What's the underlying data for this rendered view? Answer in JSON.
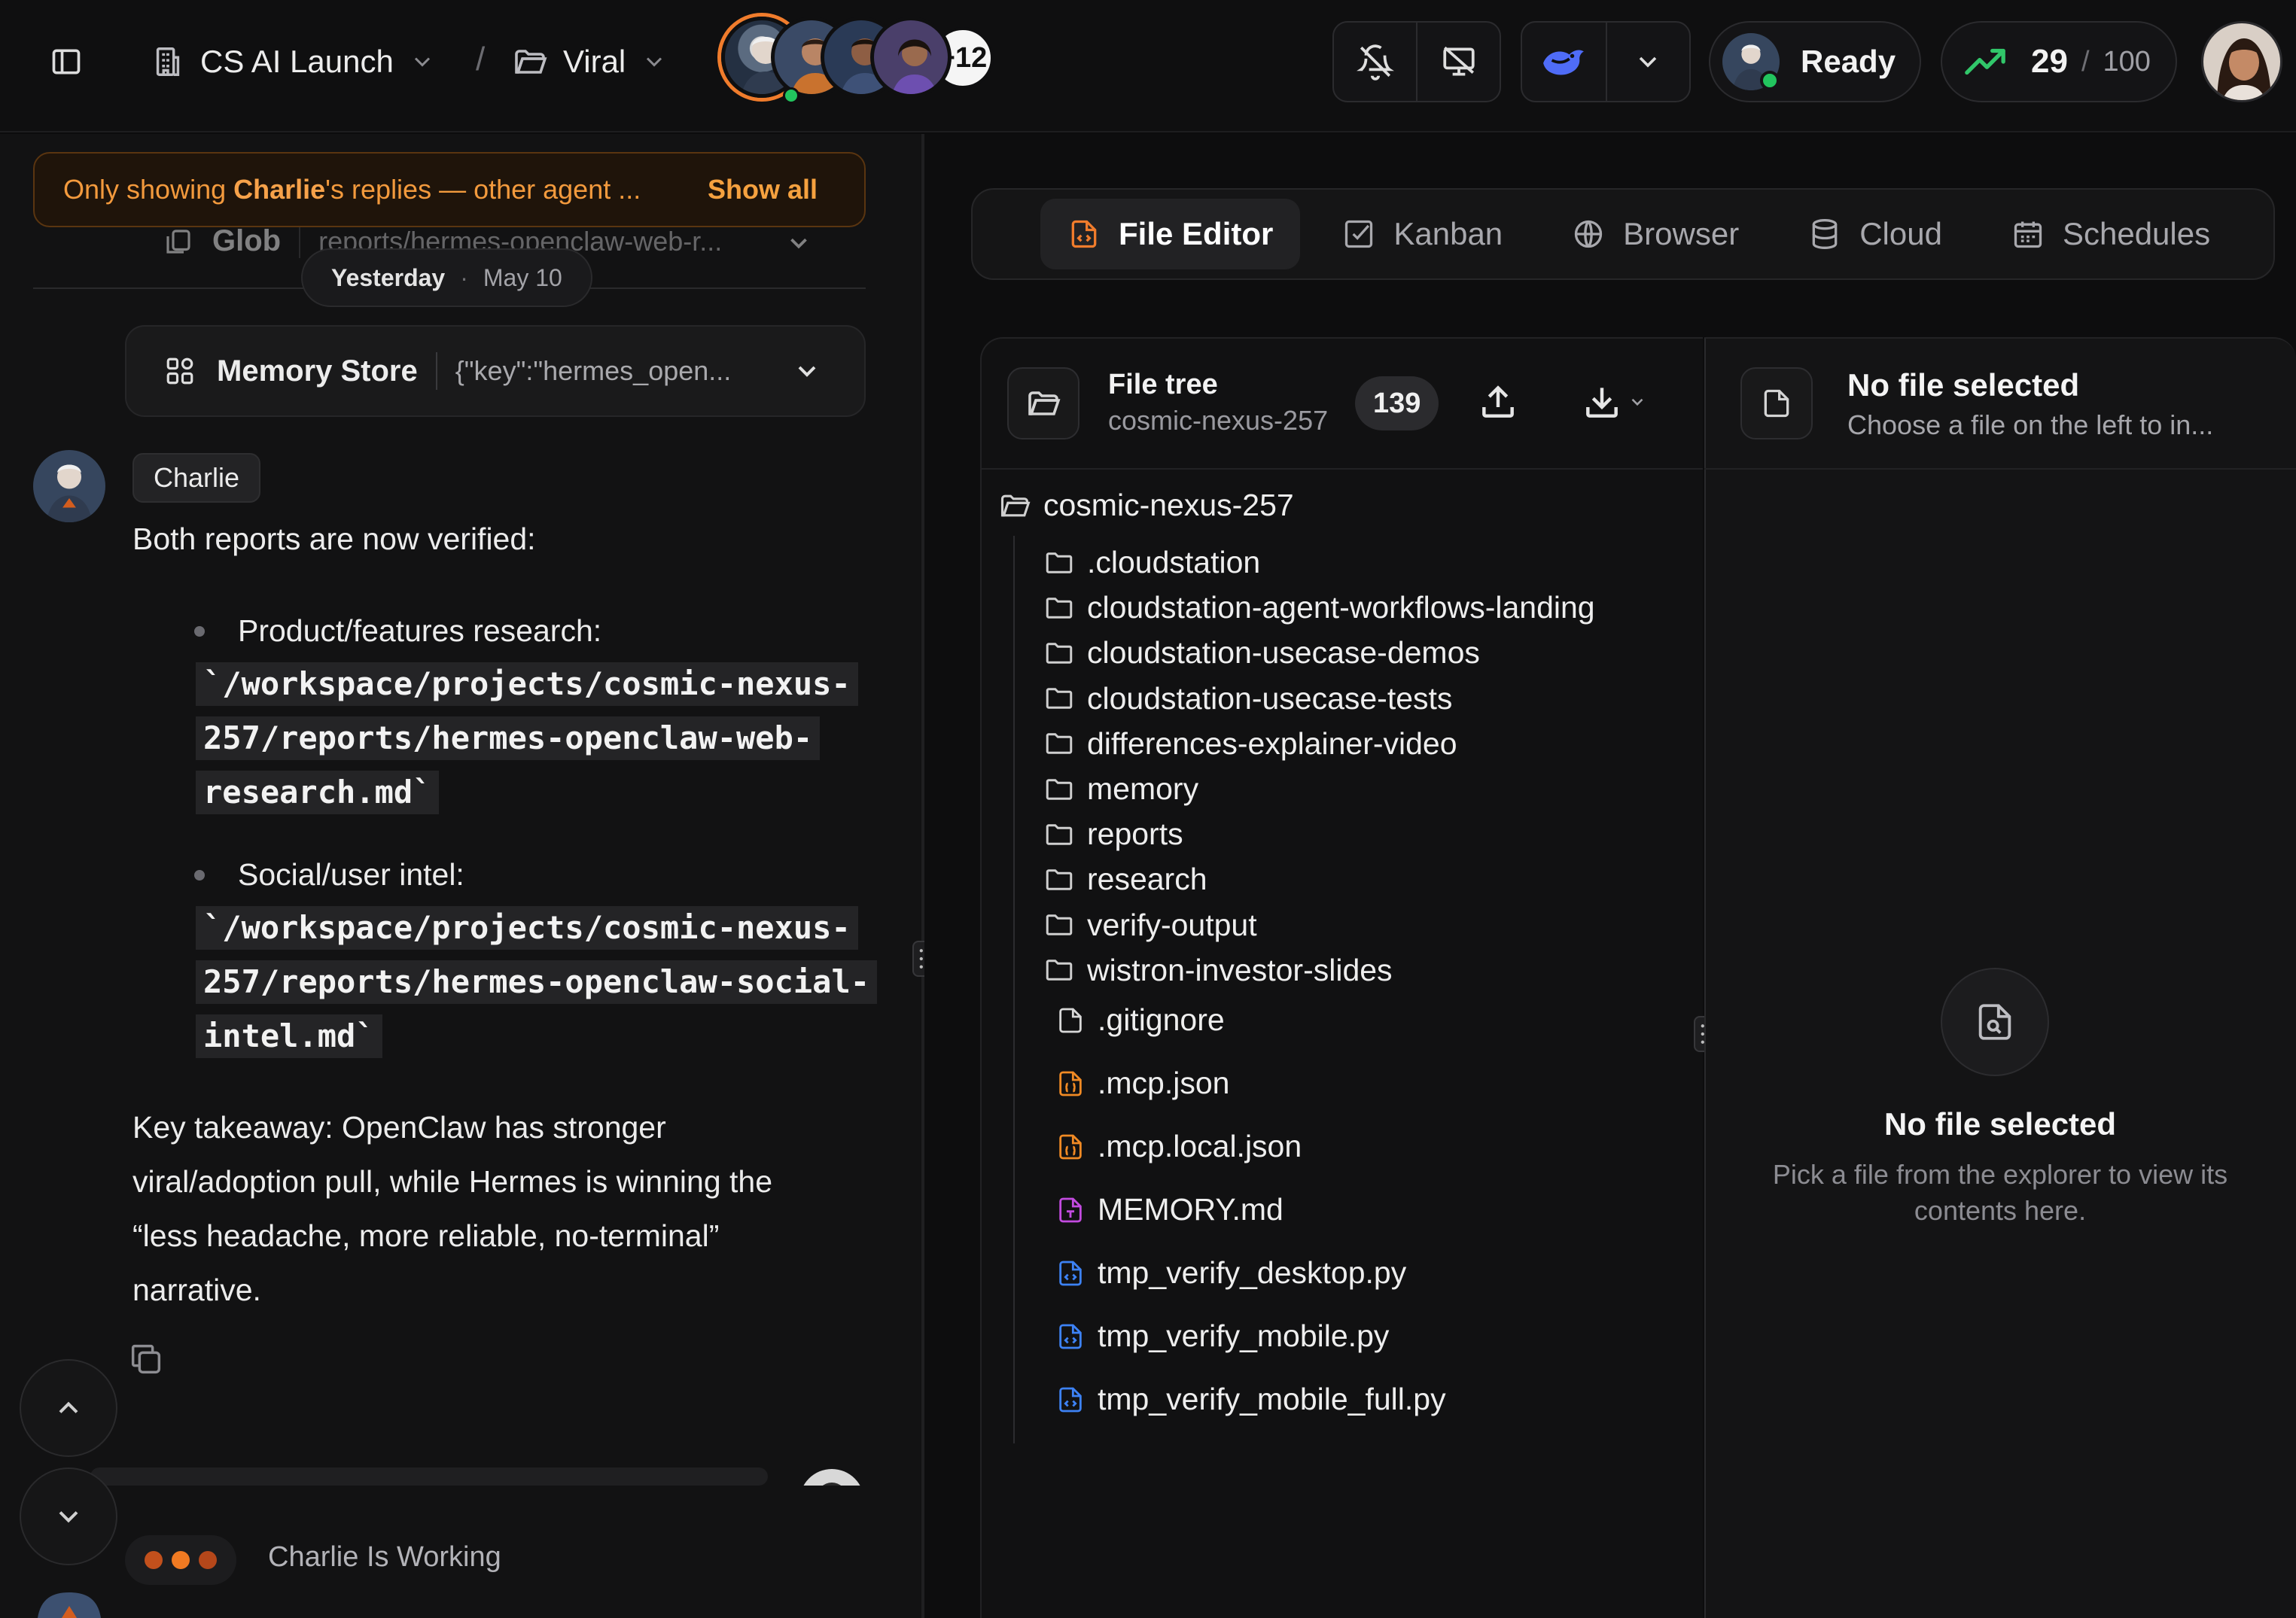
{
  "topbar": {
    "workspace": "CS AI Launch",
    "project": "Viral",
    "extra_members": "+12",
    "status": "Ready",
    "usage_current": "29",
    "usage_sep": "/",
    "usage_max": "100"
  },
  "chat": {
    "filter_banner": {
      "prefix": "Only showing ",
      "agent": "Charlie",
      "suffix": "'s replies — other agent ...",
      "action": "Show all"
    },
    "faded_card": {
      "title": "Glob",
      "value": "reports/hermes-openclaw-web-r..."
    },
    "date": {
      "relative": "Yesterday",
      "sep": "·",
      "absolute": "May 10"
    },
    "memory_card": {
      "title": "Memory Store",
      "value": "{\"key\":\"hermes_open..."
    },
    "message": {
      "author": "Charlie",
      "intro": "Both reports are now verified:",
      "bullets": [
        {
          "label": "Product/features research:",
          "code_lines": [
            "`/workspace/projects/cosmic-nexus-",
            "257/reports/hermes-openclaw-web-",
            "research.md`"
          ]
        },
        {
          "label": "Social/user intel:",
          "code_lines": [
            "`/workspace/projects/cosmic-nexus-",
            "257/reports/hermes-openclaw-social-",
            "intel.md`"
          ]
        }
      ],
      "takeaway_lines": [
        "Key takeaway: OpenClaw has stronger",
        "viral/adoption pull, while Hermes is winning the",
        "“less headache, more reliable, no-terminal”",
        "narrative."
      ]
    },
    "working_status": "Charlie Is Working",
    "working_dot_colors": [
      "#c2501c",
      "#f07a22",
      "#b5471a"
    ]
  },
  "workspace": {
    "tabs": [
      {
        "label": "File Editor",
        "active": true
      },
      {
        "label": "Kanban",
        "active": false
      },
      {
        "label": "Browser",
        "active": false
      },
      {
        "label": "Cloud",
        "active": false
      },
      {
        "label": "Schedules",
        "active": false
      }
    ],
    "file_tree": {
      "title": "File tree",
      "subtitle": "cosmic-nexus-257",
      "count": "139",
      "root": "cosmic-nexus-257",
      "folders": [
        ".cloudstation",
        "cloudstation-agent-workflows-landing",
        "cloudstation-usecase-demos",
        "cloudstation-usecase-tests",
        "differences-explainer-video",
        "memory",
        "reports",
        "research",
        "verify-output",
        "wistron-investor-slides"
      ],
      "files": [
        {
          "name": ".gitignore",
          "icon": "file-icon",
          "color": "#d8d8d8"
        },
        {
          "name": ".mcp.json",
          "icon": "json-file-icon",
          "color": "#f08a24"
        },
        {
          "name": ".mcp.local.json",
          "icon": "json-file-icon",
          "color": "#f08a24"
        },
        {
          "name": "MEMORY.md",
          "icon": "markdown-file-icon",
          "color": "#c34be0"
        },
        {
          "name": "tmp_verify_desktop.py",
          "icon": "code-file-icon",
          "color": "#3d82f5"
        },
        {
          "name": "tmp_verify_mobile.py",
          "icon": "code-file-icon",
          "color": "#3d82f5"
        },
        {
          "name": "tmp_verify_mobile_full.py",
          "icon": "code-file-icon",
          "color": "#3d82f5"
        }
      ]
    },
    "viewer": {
      "header_title": "No file selected",
      "header_subtitle": "Choose a file on the left to in...",
      "empty_title": "No file selected",
      "empty_line1": "Pick a file from the explorer to view its",
      "empty_line2": "contents here."
    }
  },
  "colors": {
    "accent_orange": "#f07c2c",
    "online_green": "#22c55e",
    "trend_green": "#31c76a",
    "brand_blue": "#4f6cf7"
  }
}
